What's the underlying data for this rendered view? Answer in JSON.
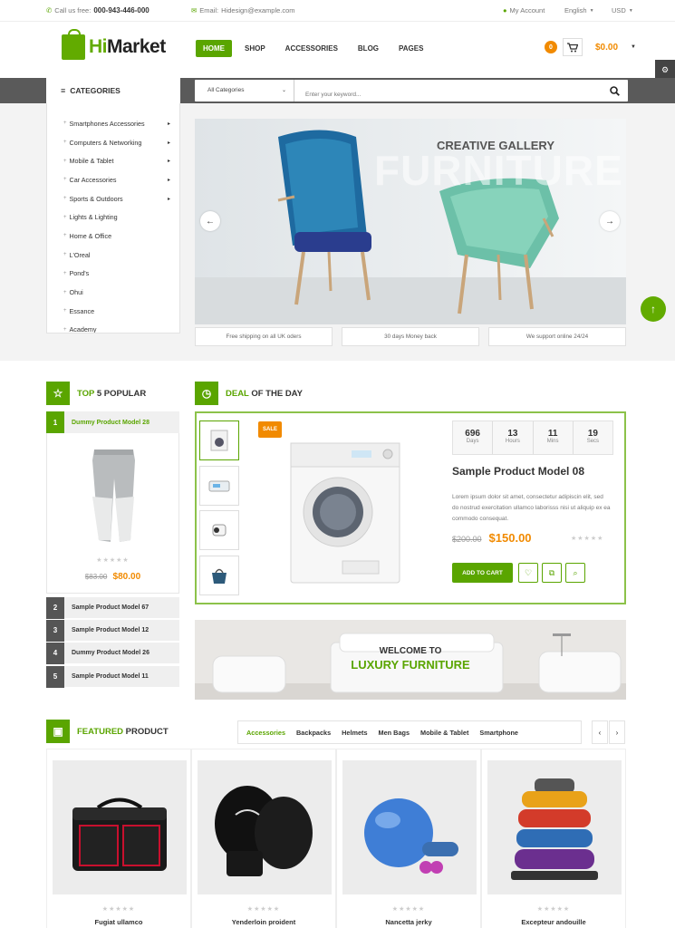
{
  "topbar": {
    "call_label": "Call us free:",
    "phone": "000-943-446-000",
    "email_label": "Email:",
    "email": "Hidesign@example.com",
    "account": "My Account",
    "language": "English",
    "currency": "USD"
  },
  "brand": {
    "prefix": "Hi",
    "name": "Market",
    "accent": "#62ab00"
  },
  "nav": {
    "items": [
      "HOME",
      "SHOP",
      "ACCESSORIES",
      "BLOG",
      "PAGES"
    ]
  },
  "cart": {
    "count": "0",
    "total": "$0.00"
  },
  "categories": {
    "heading": "CATEGORIES",
    "items": [
      {
        "label": "Smartphones Accessories",
        "arrow": "▸"
      },
      {
        "label": "Computers & Networking",
        "arrow": "▸"
      },
      {
        "label": "Mobile & Tablet",
        "arrow": "▸"
      },
      {
        "label": "Car Accessories",
        "arrow": "▸"
      },
      {
        "label": "Sports & Outdoors",
        "arrow": "▸"
      },
      {
        "label": "Lights & Lighting",
        "arrow": ""
      },
      {
        "label": "Home & Office",
        "arrow": ""
      },
      {
        "label": "L'Oreal",
        "arrow": ""
      },
      {
        "label": "Pond's",
        "arrow": ""
      },
      {
        "label": "Ohui",
        "arrow": ""
      },
      {
        "label": "Essance",
        "arrow": ""
      },
      {
        "label": "Academy",
        "arrow": ""
      }
    ]
  },
  "search": {
    "category": "All Categories",
    "placeholder": "Enter your keyword..."
  },
  "slider": {
    "title": "CREATIVE GALLERY",
    "watermark": "FURNITURE"
  },
  "services": [
    "Free shipping on all UK oders",
    "30 days Money back",
    "We support online 24/24"
  ],
  "popular": {
    "heading_accent": "TOP",
    "heading_rest": "5 POPULAR",
    "first": {
      "num": "1",
      "name": "Dummy Product Model 28",
      "old_price": "$83.00",
      "price": "$80.00"
    },
    "others": [
      {
        "num": "2",
        "name": "Sample Product Model 67"
      },
      {
        "num": "3",
        "name": "Sample Product Model 12"
      },
      {
        "num": "4",
        "name": "Dummy Product Model 26"
      },
      {
        "num": "5",
        "name": "Sample Product Model 11"
      }
    ]
  },
  "deal": {
    "heading_accent": "DEAL",
    "heading_rest": "OF THE DAY",
    "sale_badge": "SALE",
    "timer": [
      {
        "n": "696",
        "l": "Days"
      },
      {
        "n": "13",
        "l": "Hours"
      },
      {
        "n": "11",
        "l": "Mins"
      },
      {
        "n": "19",
        "l": "Secs"
      }
    ],
    "title": "Sample Product Model 08",
    "desc": "Lorem ipsum dolor sit amet, consectetur adipiscin elit, sed do nostrud exercitation ullamco laborisss nisi ut aliquip ex ea commodo consequat.",
    "old_price": "$200.00",
    "price": "$150.00",
    "add_to_cart": "ADD TO CART"
  },
  "banner": {
    "line1": "WELCOME TO",
    "line2": "LUXURY FURNITURE"
  },
  "featured": {
    "heading_accent": "FEATURED",
    "heading_rest": "PRODUCT",
    "tabs": [
      "Accessories",
      "Backpacks",
      "Helmets",
      "Men Bags",
      "Mobile & Tablet",
      "Smartphone"
    ],
    "products": [
      "Fugiat ullamco",
      "Yenderloin proident",
      "Nancetta jerky",
      "Excepteur andouille"
    ]
  },
  "stars": "★★★★★"
}
